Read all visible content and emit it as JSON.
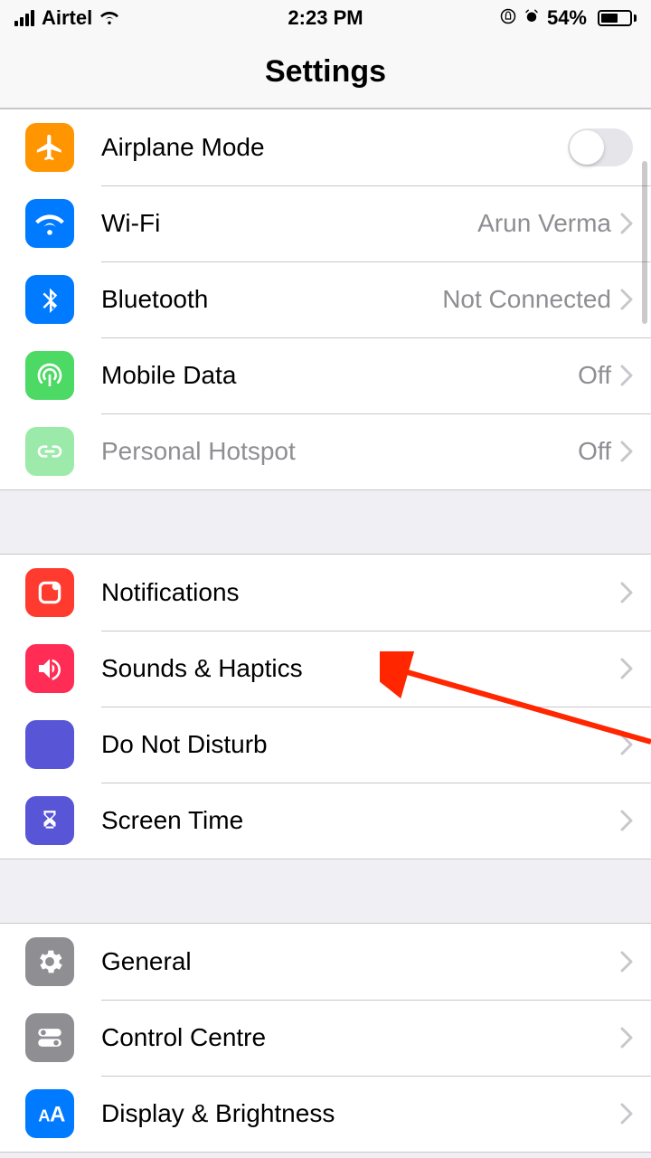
{
  "status_bar": {
    "carrier": "Airtel",
    "time": "2:23 PM",
    "battery_pct": "54%"
  },
  "header": {
    "title": "Settings"
  },
  "sections": {
    "connectivity": {
      "airplane": {
        "label": "Airplane Mode",
        "toggle": false
      },
      "wifi": {
        "label": "Wi-Fi",
        "value": "Arun Verma"
      },
      "bluetooth": {
        "label": "Bluetooth",
        "value": "Not Connected"
      },
      "mobile_data": {
        "label": "Mobile Data",
        "value": "Off"
      },
      "hotspot": {
        "label": "Personal Hotspot",
        "value": "Off"
      }
    },
    "alerts": {
      "notifications": {
        "label": "Notifications"
      },
      "sounds": {
        "label": "Sounds & Haptics"
      },
      "dnd": {
        "label": "Do Not Disturb"
      },
      "screen_time": {
        "label": "Screen Time"
      }
    },
    "system": {
      "general": {
        "label": "General"
      },
      "control_centre": {
        "label": "Control Centre"
      },
      "display": {
        "label": "Display & Brightness"
      }
    }
  }
}
